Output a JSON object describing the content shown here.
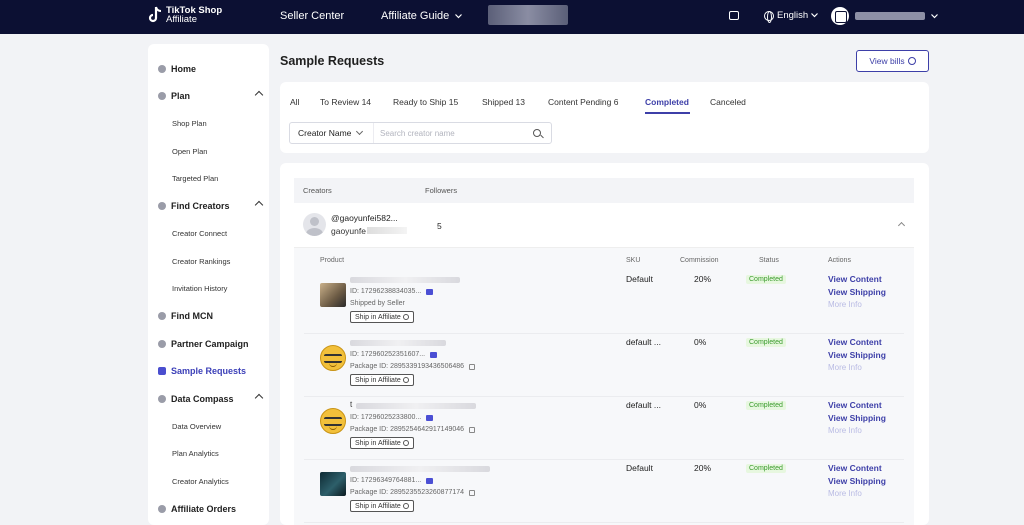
{
  "header": {
    "logo_line1": "TikTok Shop",
    "logo_line2": "Affiliate",
    "nav_seller": "Seller Center",
    "nav_affiliate": "Affiliate Guide",
    "language": "English"
  },
  "sidebar": {
    "items": [
      {
        "label": "Home"
      },
      {
        "label": "Plan"
      },
      {
        "label": "Shop Plan"
      },
      {
        "label": "Open Plan"
      },
      {
        "label": "Targeted Plan"
      },
      {
        "label": "Find Creators"
      },
      {
        "label": "Creator Connect"
      },
      {
        "label": "Creator Rankings"
      },
      {
        "label": "Invitation History"
      },
      {
        "label": "Find MCN"
      },
      {
        "label": "Partner Campaign"
      },
      {
        "label": "Sample Requests"
      },
      {
        "label": "Data Compass"
      },
      {
        "label": "Data Overview"
      },
      {
        "label": "Plan Analytics"
      },
      {
        "label": "Creator Analytics"
      },
      {
        "label": "Affiliate Orders"
      }
    ]
  },
  "main": {
    "title": "Sample Requests",
    "view_bills": "View bills",
    "tabs": [
      {
        "label": "All"
      },
      {
        "label": "To Review 14"
      },
      {
        "label": "Ready to Ship 15"
      },
      {
        "label": "Shipped 13"
      },
      {
        "label": "Content Pending 6"
      },
      {
        "label": "Completed"
      },
      {
        "label": "Canceled"
      }
    ],
    "search": {
      "select_value": "Creator Name",
      "placeholder": "Search creator name"
    }
  },
  "table": {
    "columns": {
      "creators": "Creators",
      "followers": "Followers"
    },
    "creator": {
      "handle": "@gaoyunfei582...",
      "name": "gaoyunfe",
      "followers": "5"
    },
    "sub_columns": {
      "product": "Product",
      "sku": "SKU",
      "commission": "Commission",
      "status": "Status",
      "actions": "Actions"
    },
    "rows": [
      {
        "id": "ID: 17296238834035...",
        "line2": "Shipped by Seller",
        "ship": "Ship in Affiliate",
        "sku": "Default",
        "commission": "20%",
        "status": "Completed"
      },
      {
        "id": "ID: 17296025235160​7...",
        "line2": "Package ID: 2895339193436506486",
        "ship": "Ship in Affiliate",
        "sku": "default ...",
        "commission": "0%",
        "status": "Completed"
      },
      {
        "id": "ID: 17296025233800...",
        "line2": "Package ID: 2895254642917149046",
        "ship": "Ship in Affiliate",
        "sku": "default ...",
        "commission": "0%",
        "status": "Completed"
      },
      {
        "id": "ID: 17296349764881...",
        "line2": "Package ID: 2895235523260877174",
        "ship": "Ship in Affiliate",
        "sku": "Default",
        "commission": "20%",
        "status": "Completed"
      }
    ],
    "actions": {
      "view_content": "View Content",
      "view_shipping": "View Shipping",
      "more_info": "More Info"
    },
    "row3_title_prefix": "t"
  }
}
